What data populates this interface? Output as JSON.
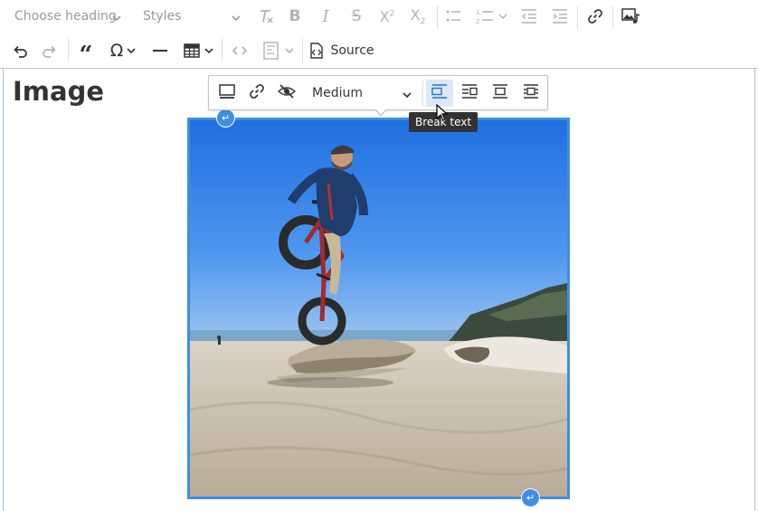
{
  "toolbar": {
    "heading_dropdown": "Choose heading",
    "styles_dropdown": "Styles",
    "source_label": "Source",
    "icons": [
      "remove-format-icon",
      "bold-icon",
      "italic-icon",
      "strikethrough-icon",
      "superscript-icon",
      "subscript-icon",
      "bulleted-list-icon",
      "numbered-list-icon",
      "outdent-icon",
      "indent-icon",
      "link-icon",
      "media-embed-icon",
      "undo-icon",
      "redo-icon",
      "blockquote-icon",
      "special-characters-icon",
      "horizontal-line-icon",
      "table-icon",
      "code-icon",
      "template-icon",
      "source-icon"
    ]
  },
  "editor": {
    "heading": "Image"
  },
  "image_toolbar": {
    "size_dropdown": "Medium",
    "icons": [
      "image-caption-icon",
      "image-link-icon",
      "alt-text-off-icon",
      "break-text-align-icon",
      "align-right-wrap-icon",
      "align-center-icon",
      "align-block-icon"
    ],
    "active": "break-text-align-icon"
  },
  "tooltip": {
    "text": "Break text"
  },
  "colors": {
    "accent": "#3f8fe0",
    "tooltip_bg": "#333333",
    "active_bg": "#dbe9f8"
  }
}
